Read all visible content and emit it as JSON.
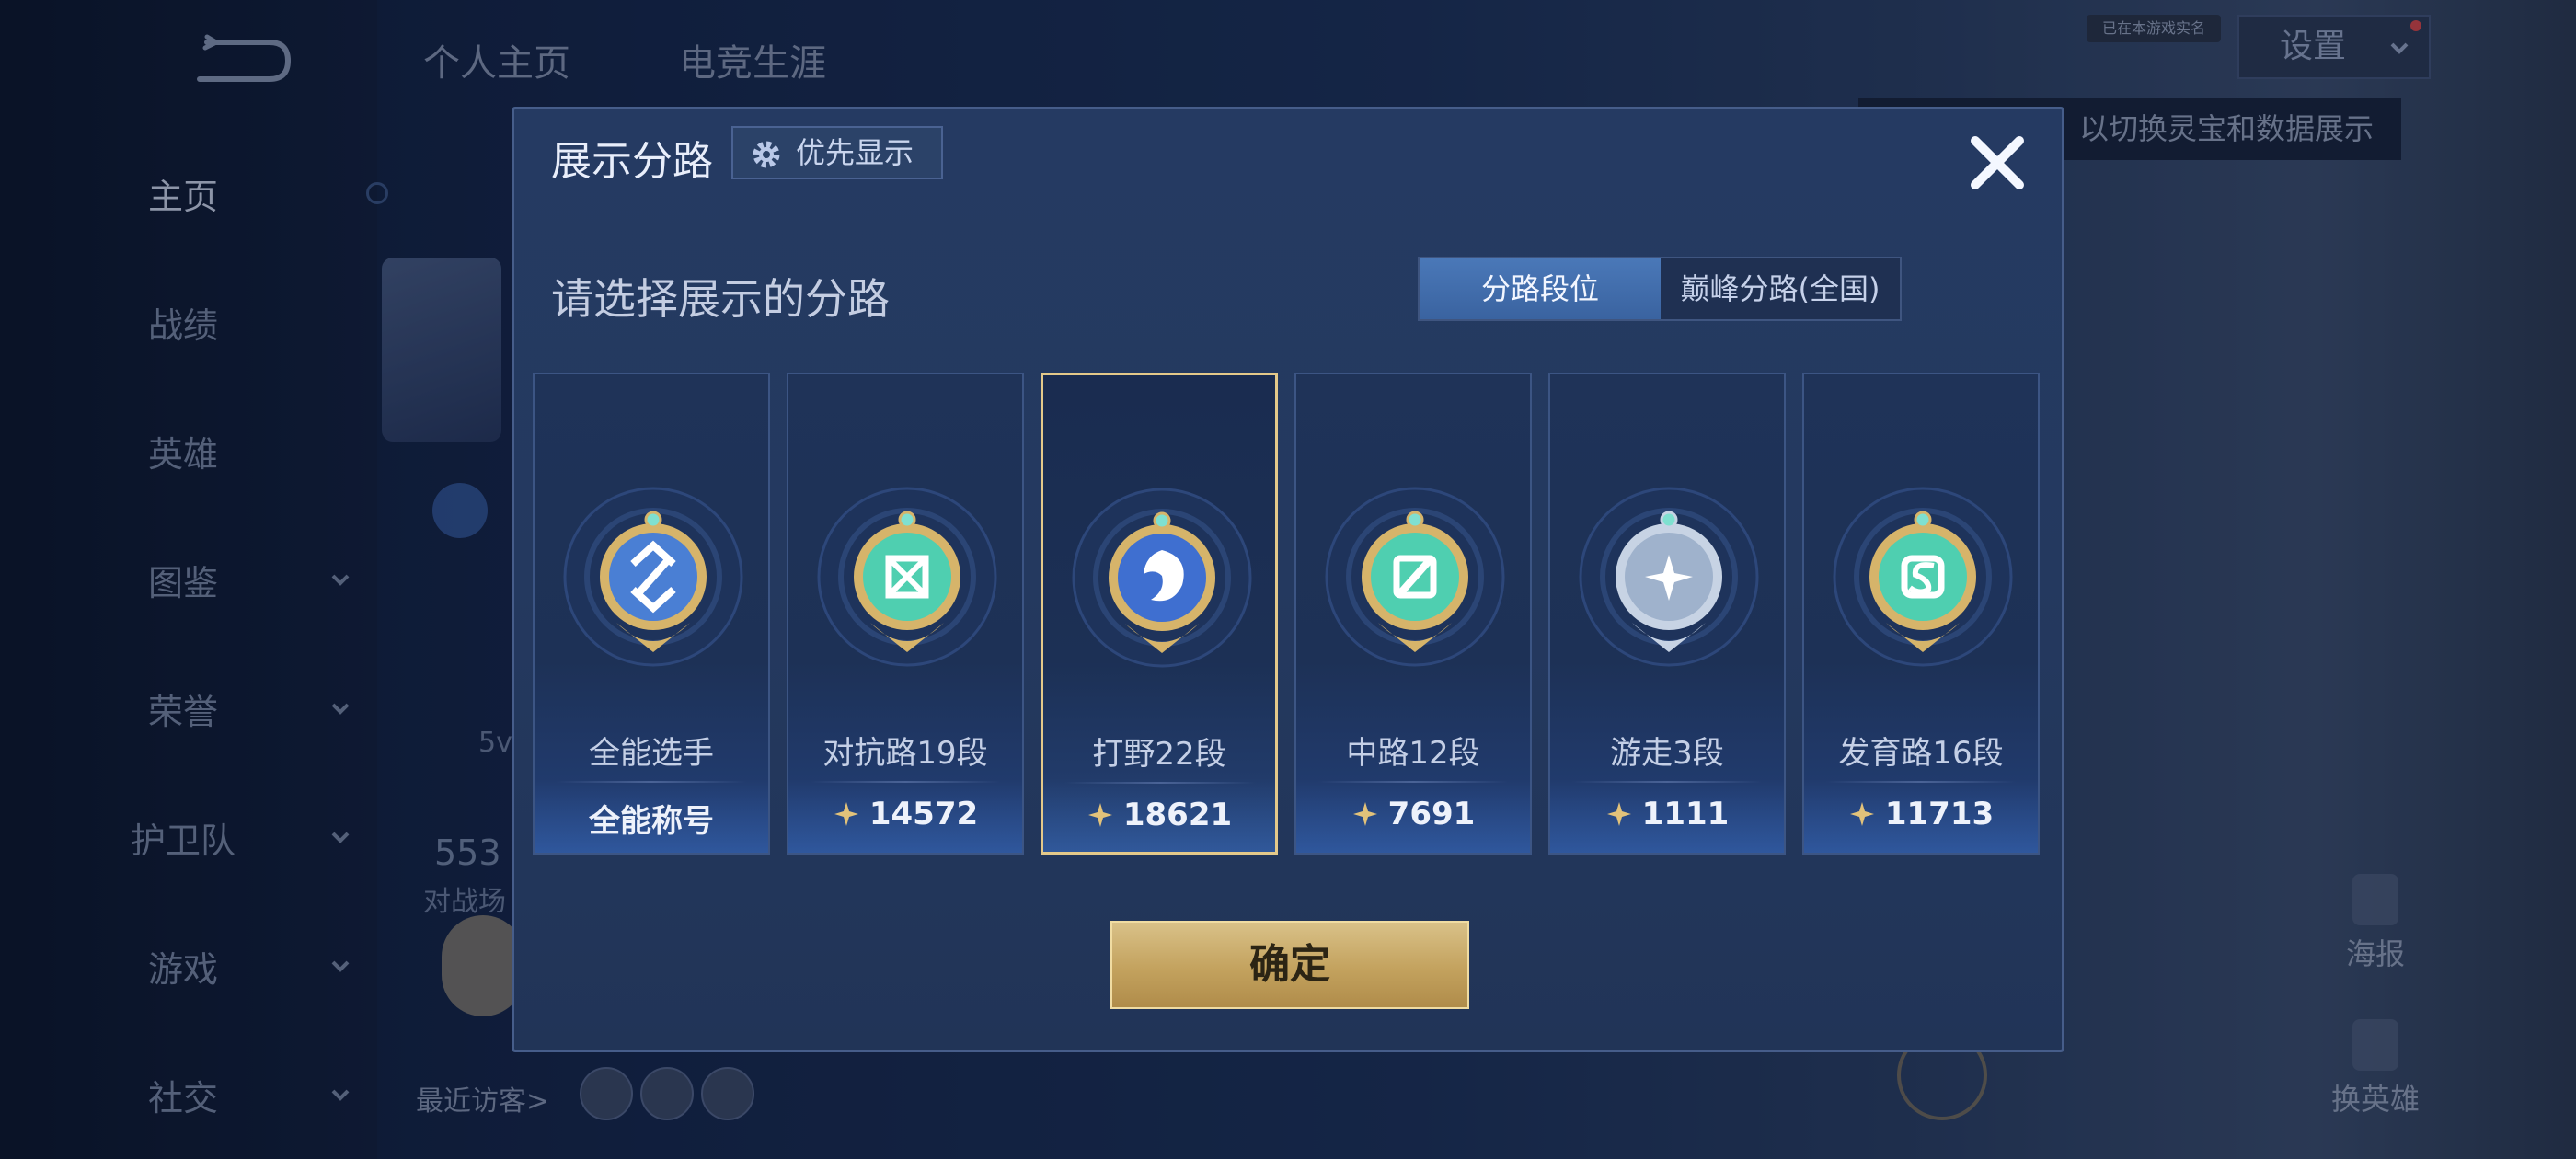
{
  "background": {
    "sidebar": {
      "items": [
        {
          "label": "主页",
          "active": true,
          "has_chevron": false
        },
        {
          "label": "战绩",
          "active": false,
          "has_chevron": false
        },
        {
          "label": "英雄",
          "active": false,
          "has_chevron": false
        },
        {
          "label": "图鉴",
          "active": false,
          "has_chevron": true
        },
        {
          "label": "荣誉",
          "active": false,
          "has_chevron": true
        },
        {
          "label": "护卫队",
          "active": false,
          "has_chevron": true
        },
        {
          "label": "游戏",
          "active": false,
          "has_chevron": true
        },
        {
          "label": "社交",
          "active": false,
          "has_chevron": true
        }
      ]
    },
    "top_tabs": [
      "个人主页",
      "电竞生涯"
    ],
    "settings_label": "设置",
    "settings_hint": "已在本游戏实名",
    "tooltip_text": "以切换灵宝和数据展示",
    "partial_number": "553",
    "partial_label": "对战场",
    "partial_mode": "5v",
    "recent_visitors_label": "最近访客>",
    "right_buttons": [
      "海报",
      "换英雄"
    ]
  },
  "modal": {
    "title": "展示分路",
    "priority_button": "优先显示",
    "subtitle": "请选择展示的分路",
    "toggle_options": [
      "分路段位",
      "巅峰分路(全国)"
    ],
    "toggle_selected": "分路段位",
    "cards": [
      {
        "name": "全能选手",
        "value": "全能称号",
        "has_points_icon": false,
        "selected": false,
        "emblem": "all-round-emblem",
        "emblem_color": "#4a7fd4"
      },
      {
        "name": "对抗路19段",
        "value": "14572",
        "has_points_icon": true,
        "selected": false,
        "emblem": "clash-lane-emblem",
        "emblem_color": "#4fcfb0"
      },
      {
        "name": "打野22段",
        "value": "18621",
        "has_points_icon": true,
        "selected": true,
        "emblem": "jungle-emblem",
        "emblem_color": "#3f6fd0"
      },
      {
        "name": "中路12段",
        "value": "7691",
        "has_points_icon": true,
        "selected": false,
        "emblem": "mid-lane-emblem",
        "emblem_color": "#4fcfb0"
      },
      {
        "name": "游走3段",
        "value": "1111",
        "has_points_icon": true,
        "selected": false,
        "emblem": "roam-emblem",
        "emblem_color": "#9fb2cc"
      },
      {
        "name": "发育路16段",
        "value": "11713",
        "has_points_icon": true,
        "selected": false,
        "emblem": "farm-lane-emblem",
        "emblem_color": "#4fcfb0"
      }
    ],
    "confirm_button": "确定"
  },
  "colors": {
    "gold": "#e4c98a",
    "accent_blue": "#4a78b8"
  },
  "icons": [
    "back-icon",
    "gear-icon",
    "close-icon",
    "chevron-down-icon",
    "points-icon"
  ]
}
